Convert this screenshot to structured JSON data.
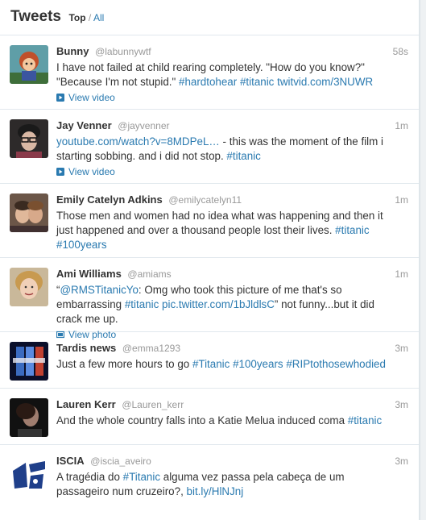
{
  "header": {
    "title": "Tweets",
    "filter_top": "Top",
    "filter_sep": "/",
    "filter_all": "All"
  },
  "colors": {
    "link": "#2a7ab0",
    "muted": "#999999",
    "text": "#333333",
    "divider": "#e1e8ed"
  },
  "tweets": [
    {
      "name": "Bunny",
      "handle": "@labunnywtf",
      "time": "58s",
      "lines": [
        [
          {
            "t": "I have not failed at child rearing completely. \"How do you know?\""
          }
        ],
        [
          {
            "t": "\"Because I'm not stupid.\" "
          },
          {
            "t": "#hardtohear",
            "link": true
          },
          {
            "t": " "
          },
          {
            "t": "#titanic",
            "link": true
          },
          {
            "t": " "
          },
          {
            "t": "twitvid.com/3NUWR",
            "link": true
          }
        ]
      ],
      "media": "View video",
      "media_icon": "play-icon"
    },
    {
      "name": "Jay Venner",
      "handle": "@jayvenner",
      "time": "1m",
      "lines": [
        [
          {
            "t": "youtube.com/watch?v=8MDPeL…",
            "link": true
          },
          {
            "t": " - this was the moment of the film i"
          }
        ],
        [
          {
            "t": "starting sobbing. and i did not stop. "
          },
          {
            "t": "#titanic",
            "link": true
          }
        ]
      ],
      "media": "View video",
      "media_icon": "play-icon"
    },
    {
      "name": "Emily Catelyn Adkins",
      "handle": "@emilycatelyn11",
      "time": "1m",
      "lines": [
        [
          {
            "t": "Those men and women had no idea what was happening and then it"
          }
        ],
        [
          {
            "t": "just happened and over a thousand people lost their lives. "
          },
          {
            "t": "#titanic",
            "link": true
          }
        ],
        [
          {
            "t": "#100years",
            "link": true
          }
        ]
      ]
    },
    {
      "name": "Ami Williams",
      "handle": "@amiams",
      "time": "1m",
      "lines": [
        [
          {
            "t": "“"
          },
          {
            "t": "@RMSTitanicYo",
            "link": true
          },
          {
            "t": ": Omg who took this picture of me that's so"
          }
        ],
        [
          {
            "t": "embarrassing "
          },
          {
            "t": "#titanic",
            "link": true
          },
          {
            "t": " "
          },
          {
            "t": "pic.twitter.com/1bJldlsC",
            "link": true
          },
          {
            "t": "” not funny...but it did"
          }
        ],
        [
          {
            "t": "crack me up."
          }
        ]
      ],
      "media": "View photo",
      "media_icon": "photo-icon"
    },
    {
      "name": "Tardis news",
      "handle": "@emma1293",
      "time": "3m",
      "lines": [
        [
          {
            "t": "Just a few more hours to go "
          },
          {
            "t": "#Titanic",
            "link": true
          },
          {
            "t": " "
          },
          {
            "t": "#100years",
            "link": true
          },
          {
            "t": " "
          },
          {
            "t": "#RIPtothosewhodied",
            "link": true
          }
        ]
      ]
    },
    {
      "name": "Lauren Kerr",
      "handle": "@Lauren_kerr",
      "time": "3m",
      "lines": [
        [
          {
            "t": "And the whole country falls into a Katie Melua induced coma "
          },
          {
            "t": "#titanic",
            "link": true
          }
        ]
      ]
    },
    {
      "name": "ISCIA",
      "handle": "@iscia_aveiro",
      "time": "3m",
      "lines": [
        [
          {
            "t": "A tragédia do "
          },
          {
            "t": "#Titanic",
            "link": true
          },
          {
            "t": " alguma vez passa pela cabeça de um"
          }
        ],
        [
          {
            "t": "passageiro num cruzeiro?, "
          },
          {
            "t": "bit.ly/HlNJnj",
            "link": true
          }
        ]
      ]
    }
  ]
}
